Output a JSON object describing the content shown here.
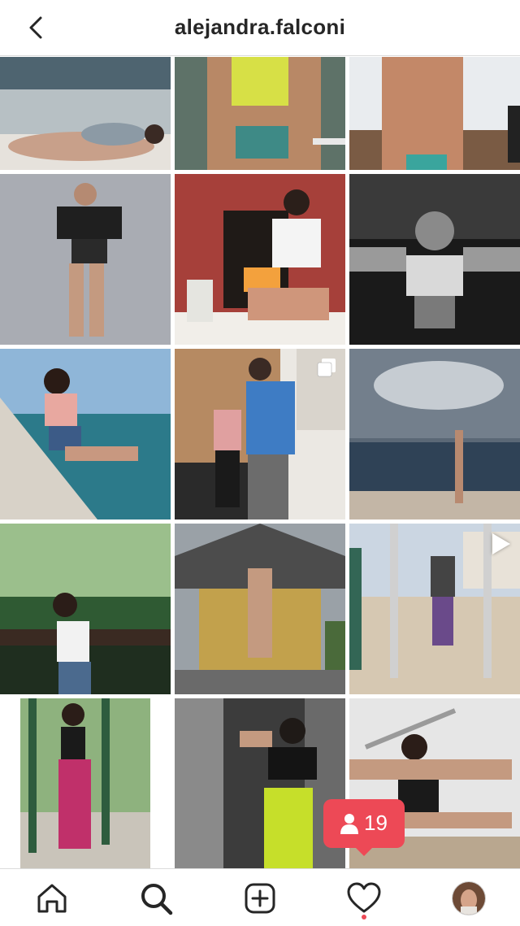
{
  "header": {
    "title": "alejandra.falconi"
  },
  "notification": {
    "followers_count": "19"
  },
  "tile_indicators": {
    "post_5": "multi-photo",
    "post_8": "reel"
  },
  "tabbar": {
    "items": [
      "home",
      "search",
      "create",
      "activity",
      "profile"
    ],
    "active": "search"
  },
  "colors": {
    "accent": "#ed4956",
    "text": "#262626",
    "divider": "#dbdbdb"
  }
}
